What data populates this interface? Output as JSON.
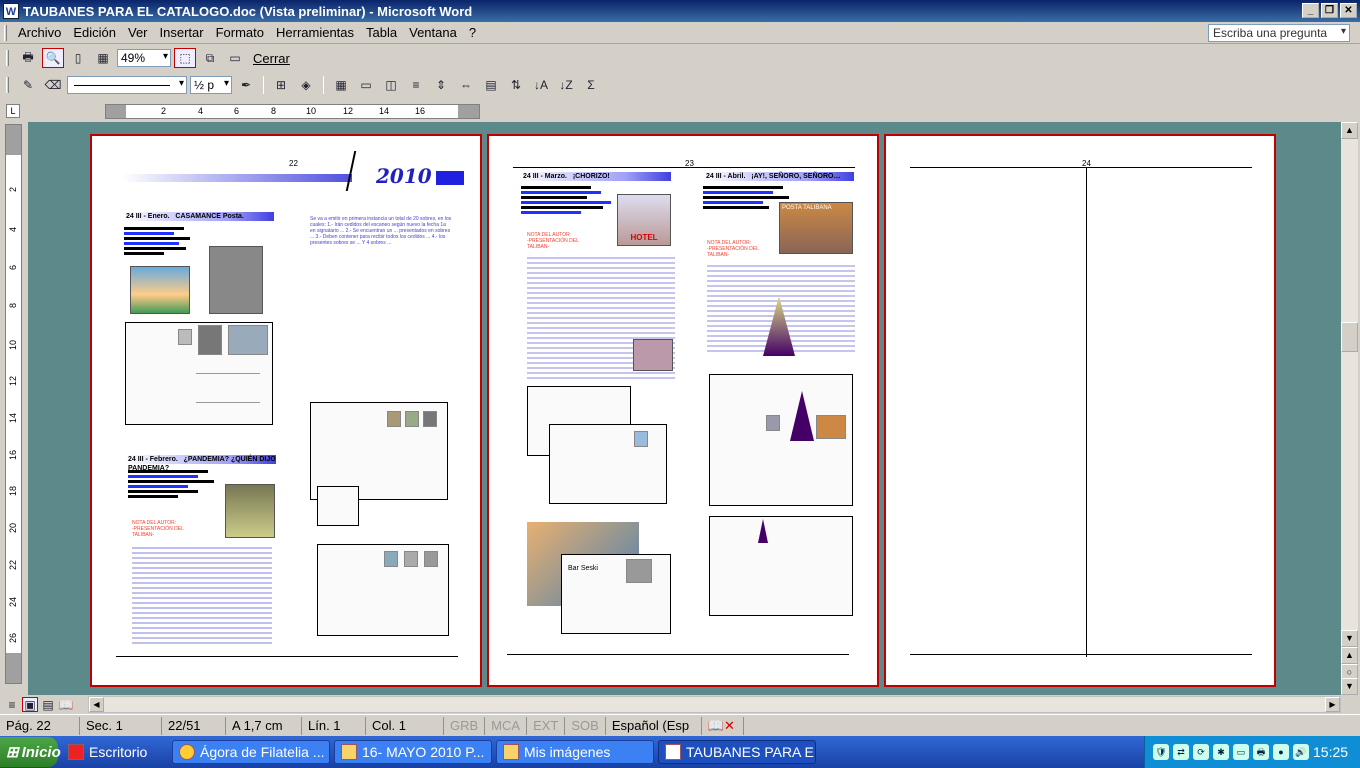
{
  "window": {
    "title": "TAUBANES PARA EL CATALOGO.doc (Vista preliminar) - Microsoft Word"
  },
  "menu": {
    "items": [
      "Archivo",
      "Edición",
      "Ver",
      "Insertar",
      "Formato",
      "Herramientas",
      "Tabla",
      "Ventana",
      "?"
    ],
    "help_placeholder": "Escriba una pregunta"
  },
  "preview_toolbar": {
    "zoom": "49%",
    "close_label": "Cerrar"
  },
  "format_toolbar": {
    "line_width": "½ p"
  },
  "hruler": {
    "ticks": [
      "2",
      "4",
      "6",
      "8",
      "10",
      "12",
      "14",
      "16"
    ]
  },
  "vruler": {
    "ticks": [
      "2",
      "4",
      "6",
      "8",
      "10",
      "12",
      "14",
      "16",
      "18",
      "20",
      "22",
      "24",
      "26"
    ]
  },
  "pages": {
    "p22": {
      "number": "22",
      "logo_year": "2010",
      "sec1_date": "24 III - Enero.",
      "sec1_title": "CASAMANCE Posta.",
      "sec2_date": "24 III - Febrero.",
      "sec2_title": "¿PANDEMIA? ¿QUIÉN DIJO PANDEMIA?",
      "author_label": "NOTA DEL AUTOR:",
      "author_sub": "-PRESENTACIÓN DEL",
      "author_sub2": "TALIBAN-",
      "right_text": "Se va a emitir en primera instancia un total de 20 sobres, en los cuales: 1.- Irán cedidos del escaneo según nuevo la fecha 1a en signatario ... 2.- Se encuentran un ... presentados en sobres ... 3.- Deben contener para recibir todos los cedidos ... 4.- los presentes sobres se ... Y 4 sobres ..."
    },
    "p23": {
      "number": "23",
      "sec1_date": "24 III - Marzo.",
      "sec1_title": "¡CHORIZO!",
      "sec2_date": "24 III - Abril.",
      "sec2_title": "¡AY!, SEÑORO, SEÑORO…",
      "author_label": "NOTA DEL AUTOR:",
      "author_sub": "-PRESENTACIÓN DEL",
      "author_sub2": "TALIBAN-",
      "stamp_text": "HOTEL",
      "stamp2_text": "POSTA TALIBANA",
      "env_label": "Bar Seski"
    },
    "p24": {
      "number": "24"
    }
  },
  "status": {
    "page": "Pág. 22",
    "section": "Sec. 1",
    "pages_count": "22/51",
    "at": "A 1,7 cm",
    "line": "Lín. 1",
    "col": "Col. 1",
    "grb": "GRB",
    "mca": "MCA",
    "ext": "EXT",
    "sob": "SOB",
    "lang": "Español (Esp"
  },
  "taskbar": {
    "start": "Inicio",
    "tasks": [
      "Escritorio",
      "Ágora de Filatelia ...",
      "16- MAYO 2010 P...",
      "Mis imágenes",
      "TAUBANES PARA E..."
    ],
    "clock": "15:25"
  }
}
